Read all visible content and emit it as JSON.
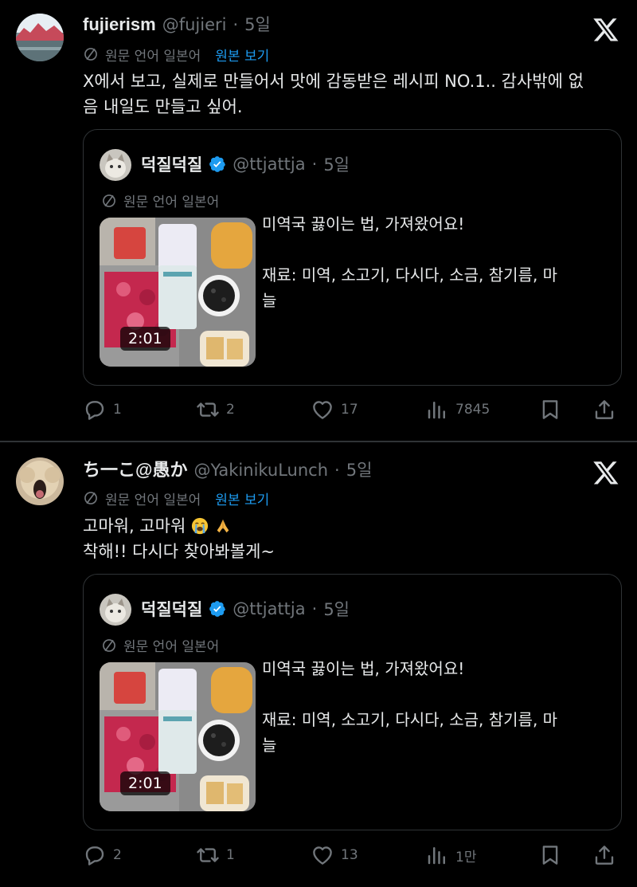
{
  "tweets": [
    {
      "name": "fujierism",
      "handle": "@fujieri",
      "dot": "·",
      "time": "5일",
      "translate_label": "원문 언어 일본어",
      "translate_link": "원본 보기",
      "lines": [
        "X에서 보고, 실제로 만들어서 맛에 감동받은 레시피 NO.1.. 감사밖에 없",
        "음 내일도 만들고 싶어."
      ],
      "quote": {
        "name": "덕질덕질",
        "handle": "@ttjattja",
        "dot": "·",
        "time": "5일",
        "translate_label": "원문 언어 일본어",
        "duration": "2:01",
        "lines": [
          "미역국 끓이는 법, 가져왔어요!",
          "",
          "재료: 미역, 소고기, 다시다, 소금, 참기름, 마",
          "늘"
        ]
      },
      "actions": {
        "replies": "1",
        "reposts": "2",
        "likes": "17",
        "views": "7845"
      }
    },
    {
      "name": "ち一こ@愚か",
      "handle": "@YakinikuLunch",
      "dot": "·",
      "time": "5일",
      "translate_label": "원문 언어 일본어",
      "translate_link": "원본 보기",
      "lines": [
        "고마워, 고마워",
        "착해!! 다시다 찾아봐볼게~"
      ],
      "emojis": [
        "loudly-crying-face",
        "folded-hands"
      ],
      "quote": {
        "name": "덕질덕질",
        "handle": "@ttjattja",
        "dot": "·",
        "time": "5일",
        "translate_label": "원문 언어 일본어",
        "duration": "2:01",
        "lines": [
          "미역국 끓이는 법, 가져왔어요!",
          "",
          "재료: 미역, 소고기, 다시다, 소금, 참기름, 마",
          "늘"
        ]
      },
      "actions": {
        "replies": "2",
        "reposts": "1",
        "likes": "13",
        "views": "1만"
      }
    }
  ],
  "colors": {
    "background": "#000000",
    "text": "#e7e9ea",
    "muted": "#71767b",
    "link": "#1d9bf0",
    "border": "#2f3336"
  }
}
